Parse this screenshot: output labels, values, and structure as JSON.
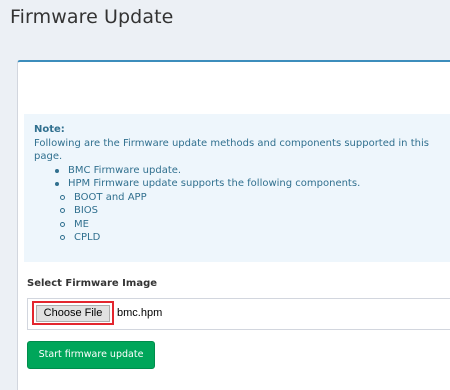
{
  "page": {
    "title": "Firmware Update"
  },
  "note": {
    "title": "Note:",
    "intro": "Following are the Firmware update methods and components supported in this page.",
    "items": [
      {
        "label": "BMC Firmware update."
      },
      {
        "label": "HPM Firmware update supports the following components."
      }
    ],
    "components": [
      "BOOT and APP",
      "BIOS",
      "ME",
      "CPLD"
    ]
  },
  "firmware_image": {
    "label": "Select Firmware Image",
    "choose_button": "Choose File",
    "file_name": "bmc.hpm"
  },
  "actions": {
    "start_update": "Start firmware update"
  },
  "colors": {
    "accent": "#3c8dbc",
    "success": "#00a65a",
    "highlight": "#e3262e",
    "info_text": "#31708f",
    "info_bg": "#eef6fc"
  }
}
